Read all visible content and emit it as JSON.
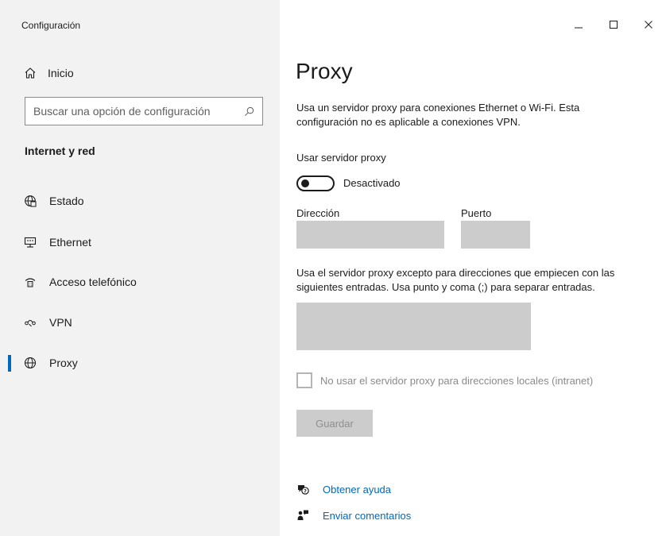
{
  "window": {
    "app_title": "Configuración",
    "controls": {
      "minimize": "minimize-icon",
      "maximize": "maximize-icon",
      "close": "close-icon"
    }
  },
  "sidebar": {
    "home_label": "Inicio",
    "search_placeholder": "Buscar una opción de configuración",
    "section_title": "Internet y red",
    "items": [
      {
        "label": "Estado",
        "icon": "globe-status-icon",
        "active": false
      },
      {
        "label": "Ethernet",
        "icon": "ethernet-icon",
        "active": false
      },
      {
        "label": "Acceso telefónico",
        "icon": "dialup-icon",
        "active": false
      },
      {
        "label": "VPN",
        "icon": "vpn-icon",
        "active": false
      },
      {
        "label": "Proxy",
        "icon": "globe-icon",
        "active": true
      }
    ]
  },
  "main": {
    "title": "Proxy",
    "description": "Usa un servidor proxy para conexiones Ethernet o Wi-Fi. Esta configuración no es aplicable a conexiones VPN.",
    "use_proxy_label": "Usar servidor proxy",
    "toggle_state": "Desactivado",
    "address_label": "Dirección",
    "address_value": "",
    "port_label": "Puerto",
    "port_value": "",
    "exceptions_text": "Usa el servidor proxy excepto para direcciones que empiecen con las siguientes entradas. Usa punto y coma (;) para separar entradas.",
    "exceptions_value": "",
    "local_checkbox_label": "No usar el servidor proxy para direcciones locales (intranet)",
    "local_checkbox_checked": false,
    "save_label": "Guardar",
    "help_link": "Obtener ayuda",
    "feedback_link": "Enviar comentarios"
  },
  "colors": {
    "accent": "#0067c0",
    "sidebar_bg": "#f2f2f2",
    "disabled_field": "#cccccc"
  }
}
